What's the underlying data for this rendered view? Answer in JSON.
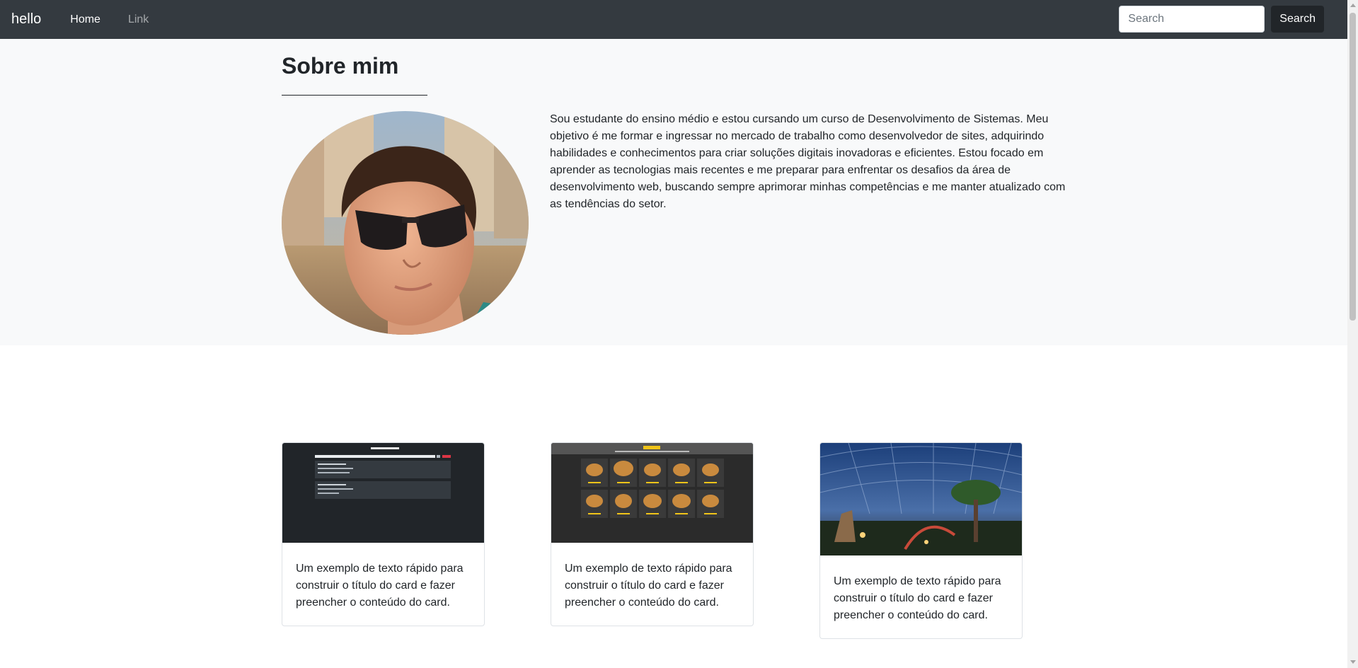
{
  "navbar": {
    "brand": "hello",
    "links": [
      {
        "label": "Home",
        "active": true
      },
      {
        "label": "Link",
        "active": false
      }
    ],
    "search": {
      "placeholder": "Search",
      "value": "",
      "button_label": "Search"
    }
  },
  "about": {
    "title": "Sobre mim",
    "text": "Sou estudante do ensino médio e estou cursando um curso de Desenvolvimento de Sistemas. Meu objetivo é me formar e ingressar no mercado de trabalho como desenvolvedor de sites, adquirindo habilidades e conhecimentos para criar soluções digitais inovadoras e eficientes. Estou focado em aprender as tecnologias mais recentes e me preparar para enfrentar os desafios da área de desenvolvimento web, buscando sempre aprimorar minhas competências e me manter atualizado com as tendências do setor."
  },
  "cards": [
    {
      "text": "Um exemplo de texto rápido para construir o título do card e fazer preencher o conteúdo do card."
    },
    {
      "text": "Um exemplo de texto rápido para construir o título do card e fazer preencher o conteúdo do card."
    },
    {
      "text": "Um exemplo de texto rápido para construir o título do card e fazer preencher o conteúdo do card."
    }
  ],
  "colors": {
    "navbar": "#343a40",
    "about_bg": "#f8f9fa",
    "button": "#212529"
  }
}
